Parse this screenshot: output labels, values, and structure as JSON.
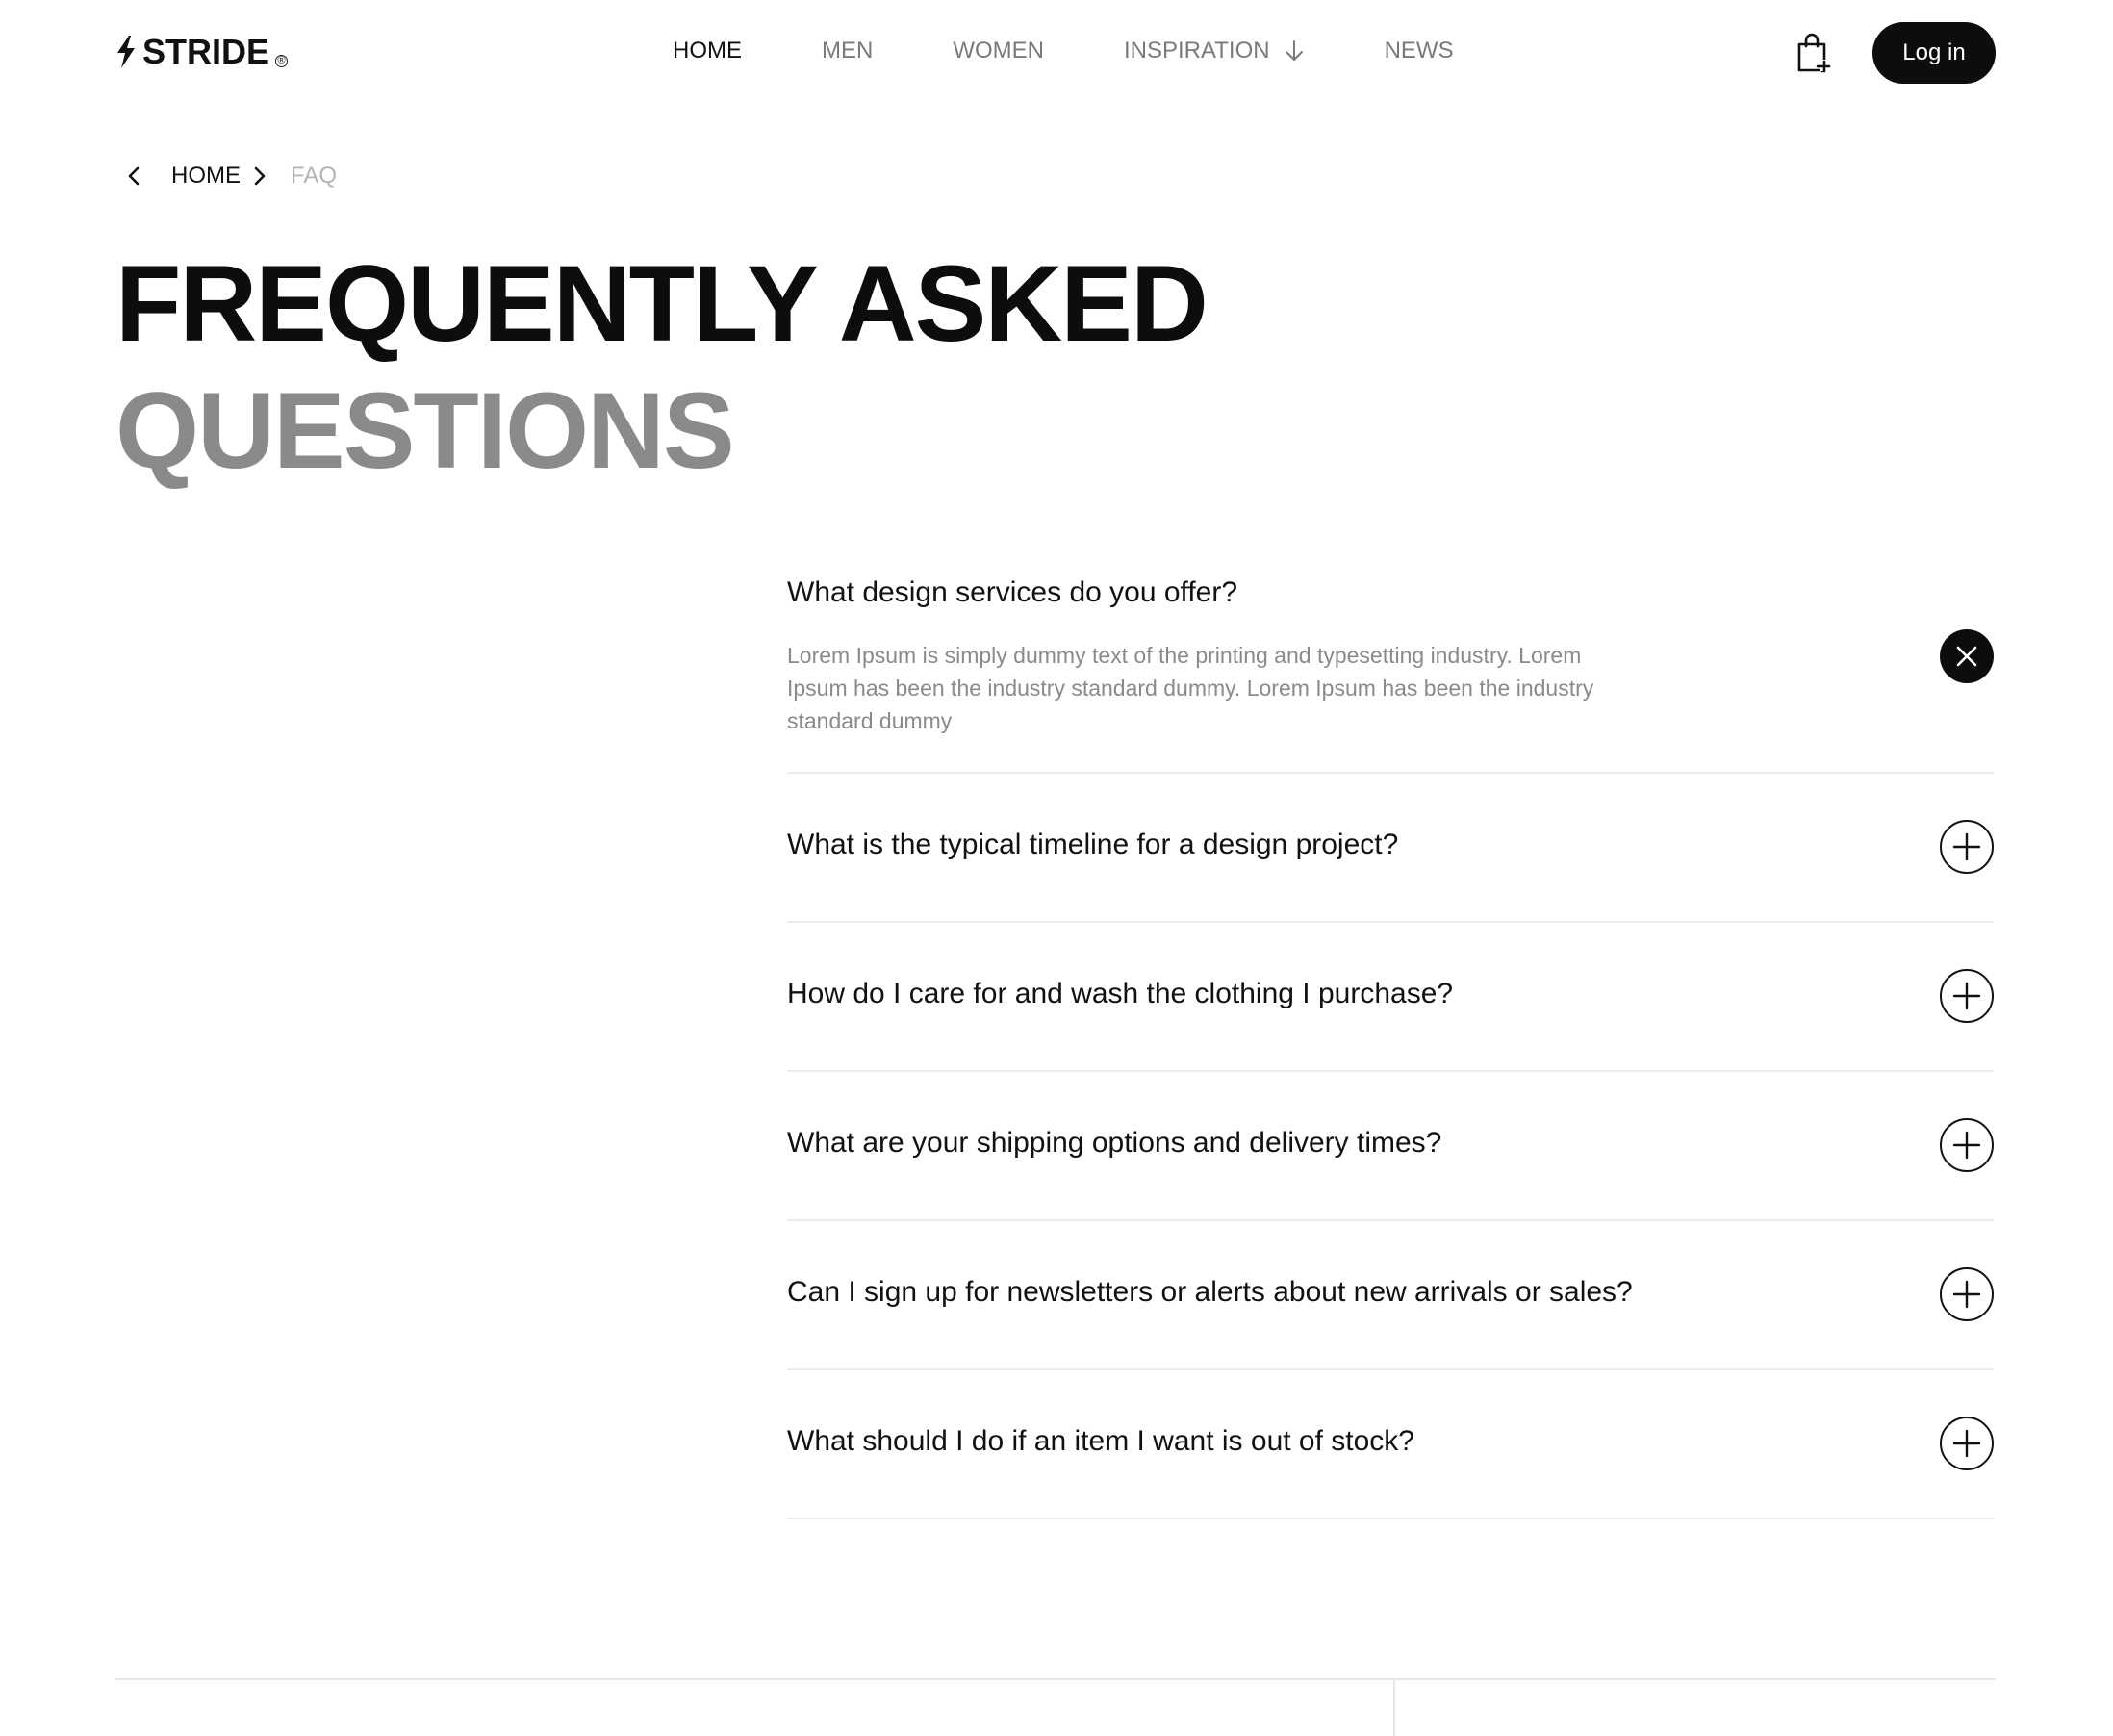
{
  "brand": {
    "name": "STRIDE",
    "mark": "®"
  },
  "nav": {
    "items": [
      {
        "label": "HOME",
        "active": true
      },
      {
        "label": "MEN",
        "active": false
      },
      {
        "label": "WOMEN",
        "active": false
      },
      {
        "label": "INSPIRATION",
        "active": false,
        "icon": "arrow-down-icon"
      },
      {
        "label": "NEWS",
        "active": false
      }
    ],
    "cart_icon": "shopping-bag-icon",
    "login_label": "Log in"
  },
  "breadcrumb": {
    "back_icon": "chevron-left-icon",
    "home": "HOME",
    "separator_icon": "chevron-right-icon",
    "current": "FAQ"
  },
  "title": {
    "line1": "FREQUENTLY ASKED",
    "line2": "QUESTIONS"
  },
  "faq": {
    "items": [
      {
        "question": "What design services do you offer?",
        "answer": "Lorem Ipsum is simply dummy text of the printing and typesetting industry. Lorem Ipsum has been the industry standard dummy. Lorem Ipsum has been the industry standard dummy",
        "expanded": true,
        "toggle_icon": "close-icon"
      },
      {
        "question": "What is the typical timeline for a design project?",
        "expanded": false,
        "toggle_icon": "plus-icon"
      },
      {
        "question": "How do I care for and wash the clothing I purchase?",
        "expanded": false,
        "toggle_icon": "plus-icon"
      },
      {
        "question": "What are your shipping options and delivery times?",
        "expanded": false,
        "toggle_icon": "plus-icon"
      },
      {
        "question": "Can I sign up for newsletters or alerts about new arrivals or sales?",
        "expanded": false,
        "toggle_icon": "plus-icon"
      },
      {
        "question": "What should I do if an item I want is out of stock?",
        "expanded": false,
        "toggle_icon": "plus-icon"
      }
    ]
  },
  "colors": {
    "primary": "#0d0d0d",
    "muted_text": "#8a8a8a",
    "inactive_nav": "#7a7a7a",
    "breadcrumb_current": "#b5b5b5",
    "divider": "#ececec",
    "background": "#ffffff"
  }
}
